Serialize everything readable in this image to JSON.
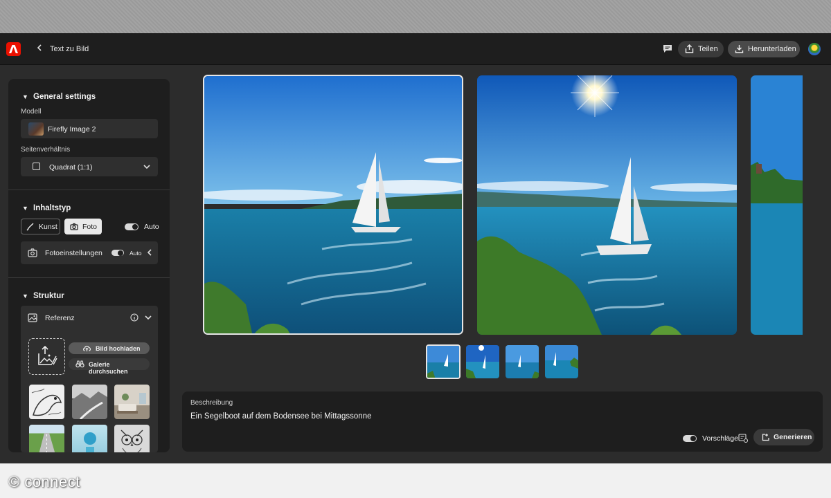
{
  "watermark": "© connect",
  "header": {
    "title": "Text zu Bild",
    "share_label": "Teilen",
    "download_label": "Herunterladen"
  },
  "sidebar": {
    "general": {
      "title": "General settings",
      "model_label": "Modell",
      "model_value": "Firefly Image 2",
      "aspect_label": "Seitenverhältnis",
      "aspect_value": "Quadrat (1:1)"
    },
    "content_type": {
      "title": "Inhaltstyp",
      "options": [
        "Kunst",
        "Foto"
      ],
      "selected": "Foto",
      "auto_label": "Auto",
      "photo_settings_label": "Fotoeinstellungen",
      "photo_auto_label": "Auto"
    },
    "structure": {
      "title": "Struktur",
      "reference_label": "Referenz",
      "upload_label": "Bild hochladen",
      "gallery_label": "Galerie durchsuchen"
    }
  },
  "prompt": {
    "label": "Beschreibung",
    "text": "Ein Segelboot auf dem Bodensee bei Mittagssonne",
    "suggestions_label": "Vorschläge",
    "generate_label": "Generieren"
  },
  "colors": {
    "accent": "#eb1000",
    "app_bg": "#2c2c2c",
    "panel_bg": "#1e1e1e"
  },
  "thumbnails_count": 4,
  "selected_thumbnail": 1
}
